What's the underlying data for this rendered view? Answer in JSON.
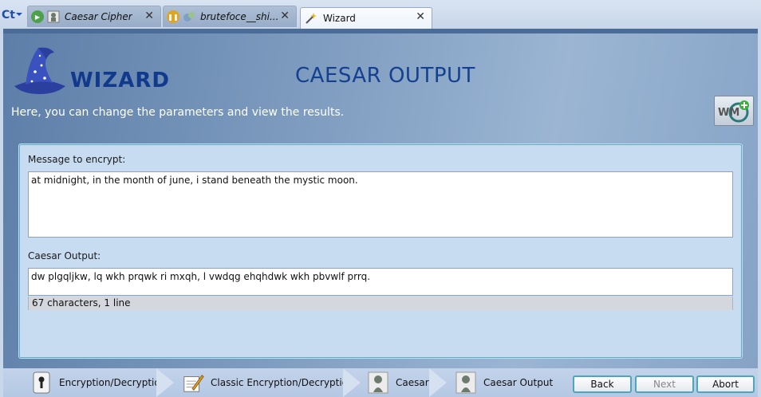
{
  "tabs": [
    {
      "label": "Caesar Cipher",
      "status": "running"
    },
    {
      "label": "brutefoce__shi...",
      "status": "paused"
    },
    {
      "label": "Wizard",
      "status": "active"
    }
  ],
  "wizard": {
    "brand": "WIZARD",
    "title": "CAESAR OUTPUT",
    "description": "Here, you can change the parameters and view the results.",
    "badge_text": "WM"
  },
  "input": {
    "label": "Message to encrypt:",
    "value": "at midnight, in the month of june, i stand beneath the mystic moon."
  },
  "output": {
    "label": "Caesar Output:",
    "value": "dw plgqljkw, lq wkh prqwk ri mxqh, l vwdqg ehqhdwk wkh pbvwlf prrq.",
    "status": "67 characters,  1 line"
  },
  "breadcrumbs": [
    {
      "label": "Encryption/Decryption",
      "icon": "keyhole-icon"
    },
    {
      "label": "Classic Encryption/Decryption",
      "icon": "pencil-paper-icon"
    },
    {
      "label": "Caesar",
      "icon": "caesar-bust-icon"
    },
    {
      "label": "Caesar Output",
      "icon": "caesar-bust-icon"
    }
  ],
  "buttons": {
    "back": "Back",
    "next": "Next",
    "abort": "Abort"
  },
  "colors": {
    "panel_accent": "#14408f",
    "button_border": "#4ba7b9"
  }
}
